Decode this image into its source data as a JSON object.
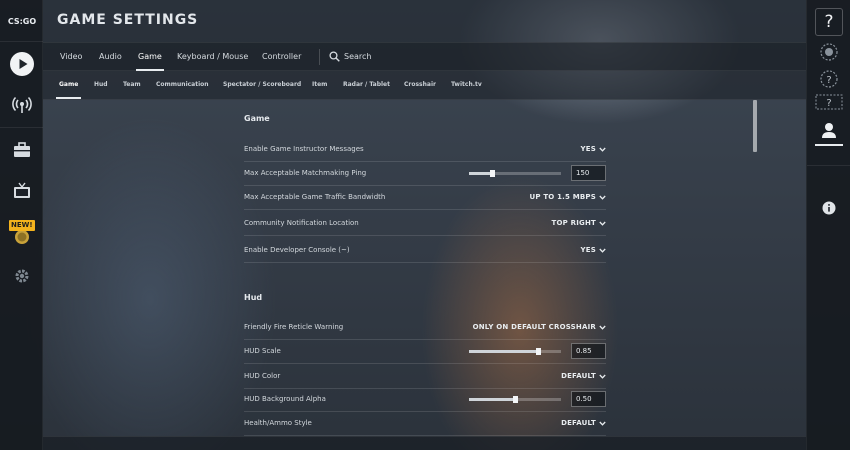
{
  "app": {
    "logo_text": "CS:GO",
    "new_badge": "NEW!"
  },
  "header": {
    "title": "GAME SETTINGS"
  },
  "tabs": [
    {
      "label": "Video"
    },
    {
      "label": "Audio"
    },
    {
      "label": "Game",
      "active": true
    },
    {
      "label": "Keyboard / Mouse"
    },
    {
      "label": "Controller"
    }
  ],
  "search": {
    "label": "Search"
  },
  "subtabs": [
    {
      "label": "Game",
      "active": true
    },
    {
      "label": "Hud"
    },
    {
      "label": "Team"
    },
    {
      "label": "Communication"
    },
    {
      "label": "Spectator / Scoreboard"
    },
    {
      "label": "Item"
    },
    {
      "label": "Radar / Tablet"
    },
    {
      "label": "Crosshair"
    },
    {
      "label": "Twitch.tv"
    }
  ],
  "sections": {
    "game": {
      "title": "Game",
      "rows": [
        {
          "label": "Enable Game Instructor Messages",
          "value": "YES"
        },
        {
          "label": "Max Acceptable Matchmaking Ping",
          "input": "150",
          "slider": 0.25
        },
        {
          "label": "Max Acceptable Game Traffic Bandwidth",
          "value": "UP TO 1.5 MBPS"
        },
        {
          "label": "Community Notification Location",
          "value": "TOP RIGHT"
        },
        {
          "label": "Enable Developer Console (~)",
          "value": "YES"
        }
      ]
    },
    "hud": {
      "title": "Hud",
      "rows": [
        {
          "label": "Friendly Fire Reticle Warning",
          "value": "ONLY ON DEFAULT CROSSHAIR"
        },
        {
          "label": "HUD Scale",
          "input": "0.85",
          "slider": 0.75
        },
        {
          "label": "HUD Color",
          "value": "DEFAULT"
        },
        {
          "label": "HUD Background Alpha",
          "input": "0.50",
          "slider": 0.5
        },
        {
          "label": "Health/Ammo Style",
          "value": "DEFAULT"
        }
      ]
    }
  },
  "colors": {
    "accent": "#e8ecef",
    "badge": "#f3b21d"
  }
}
